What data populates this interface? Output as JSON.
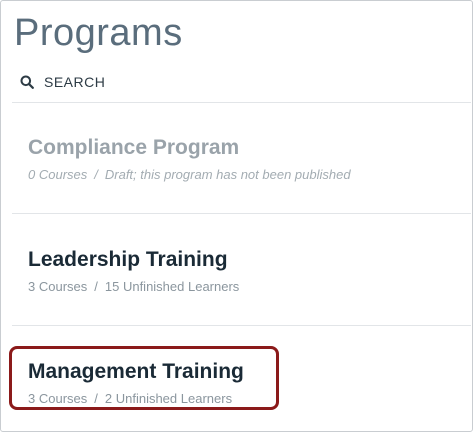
{
  "page": {
    "title": "Programs"
  },
  "search": {
    "icon": "search-icon",
    "label": "SEARCH"
  },
  "programs": [
    {
      "name": "Compliance Program",
      "courses": "0 Courses",
      "separator": "/",
      "status": "Draft; this program has not been published",
      "state": "draft"
    },
    {
      "name": "Leadership Training",
      "courses": "3 Courses",
      "separator": "/",
      "status": "15 Unfinished Learners",
      "state": "published"
    },
    {
      "name": "Management Training",
      "courses": "3 Courses",
      "separator": "/",
      "status": "2 Unfinished Learners",
      "state": "published",
      "highlighted": true
    }
  ],
  "colors": {
    "title": "#5a6d7c",
    "program_name": "#1a2a36",
    "meta_text": "#8b969e",
    "draft_text": "#9aa3aa",
    "highlight_border": "#8b1a1a",
    "divider": "#e2e5e8"
  }
}
